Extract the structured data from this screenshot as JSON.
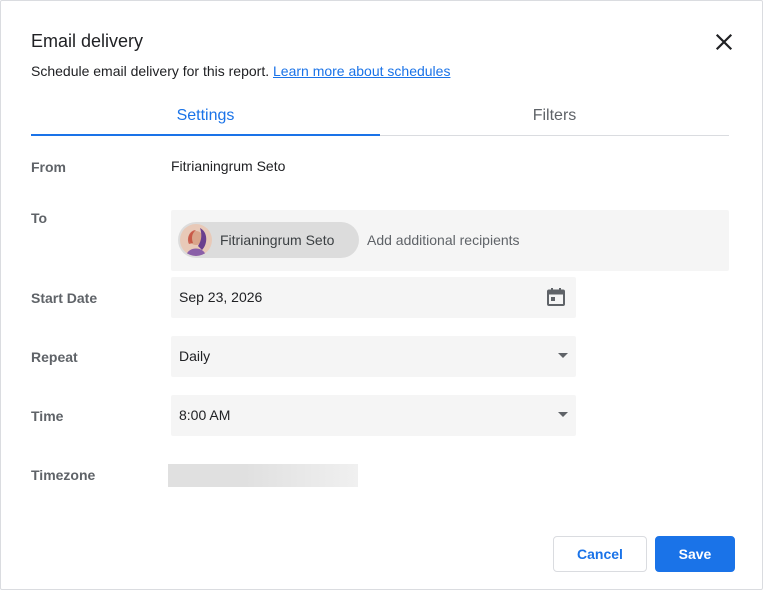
{
  "dialog": {
    "title": "Email delivery",
    "subtitle": "Schedule email delivery for this report.",
    "learn_more": "Learn more about schedules"
  },
  "tabs": [
    {
      "label": "Settings",
      "active": true
    },
    {
      "label": "Filters",
      "active": false
    }
  ],
  "form": {
    "from_label": "From",
    "from_value": "Fitrianingrum Seto",
    "to_label": "To",
    "recipient_chip": "Fitrianingrum Seto",
    "recipients_placeholder": "Add additional recipients",
    "start_date_label": "Start Date",
    "start_date_value": "Sep 23, 2026",
    "repeat_label": "Repeat",
    "repeat_value": "Daily",
    "time_label": "Time",
    "time_value": "8:00 AM",
    "timezone_label": "Timezone"
  },
  "actions": {
    "cancel": "Cancel",
    "save": "Save"
  },
  "icons": {
    "close": "close-icon",
    "calendar": "calendar-icon",
    "dropdown": "chevron-down-icon",
    "avatar": "avatar"
  },
  "colors": {
    "accent": "#1a73e8",
    "field_bg": "#f5f5f5",
    "chip_bg": "#dcdcdc",
    "label": "#5f6368"
  }
}
